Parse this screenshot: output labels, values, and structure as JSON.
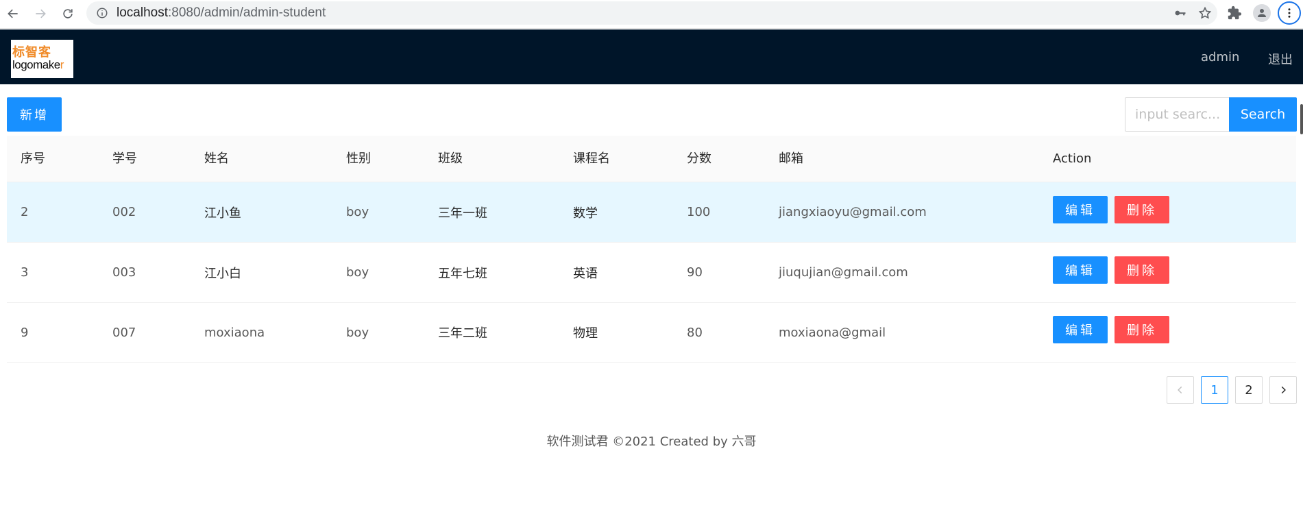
{
  "browser": {
    "url_host": "localhost",
    "url_rest": ":8080/admin/admin-student",
    "icons": [
      "back-arrow-icon",
      "forward-arrow-icon",
      "reload-icon",
      "info-icon",
      "key-icon",
      "star-icon",
      "extensions-icon",
      "profile-icon",
      "menu-kebab-icon"
    ]
  },
  "header": {
    "logo_top": "标智客",
    "logo_bottom_main": "logomake",
    "logo_bottom_accent": "r",
    "user": "admin",
    "logout": "退出",
    "background": "#001529"
  },
  "toolbar": {
    "add_label": "新增",
    "search_placeholder": "input searc...",
    "search_label": "Search"
  },
  "table": {
    "columns": [
      "序号",
      "学号",
      "姓名",
      "性别",
      "班级",
      "课程名",
      "分数",
      "邮箱",
      "Action"
    ],
    "rows": [
      {
        "id": "2",
        "student_no": "002",
        "name": "江小鱼",
        "gender": "boy",
        "class": "三年一班",
        "course": "数学",
        "score": "100",
        "email": "jiangxiaoyu@gmail.com"
      },
      {
        "id": "3",
        "student_no": "003",
        "name": "江小白",
        "gender": "boy",
        "class": "五年七班",
        "course": "英语",
        "score": "90",
        "email": "jiuqujian@gmail.com"
      },
      {
        "id": "9",
        "student_no": "007",
        "name": "moxiaona",
        "gender": "boy",
        "class": "三年二班",
        "course": "物理",
        "score": "80",
        "email": "moxiaona@gmail"
      }
    ],
    "edit_label": "编辑",
    "delete_label": "删除"
  },
  "pagination": {
    "pages": [
      "1",
      "2"
    ],
    "current": "1"
  },
  "footer": "软件测试君 ©2021 Created by 六哥",
  "colors": {
    "primary": "#1890ff",
    "danger": "#ff4d4f",
    "row_highlight": "#e6f7ff"
  }
}
